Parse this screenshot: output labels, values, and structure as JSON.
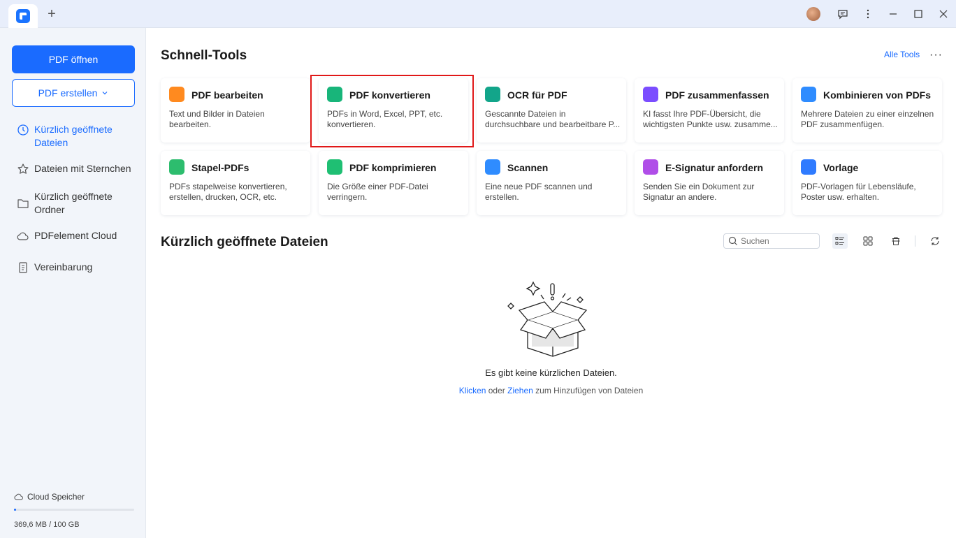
{
  "sidebar": {
    "open_pdf": "PDF öffnen",
    "create_pdf": "PDF erstellen",
    "nav": [
      {
        "label": "Kürzlich geöffnete Dateien",
        "active": true
      },
      {
        "label": "Dateien mit Sternchen"
      },
      {
        "label": "Kürzlich geöffnete Ordner"
      },
      {
        "label": "PDFelement Cloud"
      },
      {
        "label": "Vereinbarung"
      }
    ],
    "storage": {
      "title": "Cloud Speicher",
      "value": "369,6 MB / 100 GB",
      "used_fraction": 0.0036
    }
  },
  "quick_tools": {
    "title": "Schnell-Tools",
    "all_tools": "Alle Tools",
    "cards": [
      {
        "title": "PDF bearbeiten",
        "desc1": "Text und Bilder in Dateien",
        "desc2": "bearbeiten.",
        "color": "#ff8a1f",
        "icon": "edit-pdf-icon"
      },
      {
        "title": "PDF konvertieren",
        "desc1": "PDFs in Word, Excel, PPT, etc.",
        "desc2": "konvertieren.",
        "color": "#18b57a",
        "icon": "convert-pdf-icon"
      },
      {
        "title": "OCR für PDF",
        "desc1": "Gescannte Dateien in",
        "desc2": "durchsuchbare und bearbeitbare P...",
        "color": "#12a58a",
        "icon": "ocr-icon"
      },
      {
        "title": "PDF zusammenfassen",
        "desc1": "KI fasst Ihre PDF-Übersicht, die",
        "desc2": "wichtigsten Punkte usw. zusamme...",
        "color": "#7b4dff",
        "icon": "summarize-icon"
      },
      {
        "title": "Kombinieren von PDFs",
        "desc1": "Mehrere Dateien zu einer einzelnen",
        "desc2": "PDF zusammenfügen.",
        "color": "#2f8cff",
        "icon": "combine-icon"
      },
      {
        "title": "Stapel-PDFs",
        "desc1": "PDFs stapelweise konvertieren,",
        "desc2": "erstellen, drucken, OCR, etc.",
        "color": "#2dbd6e",
        "icon": "batch-icon"
      },
      {
        "title": "PDF komprimieren",
        "desc1": "Die Größe einer PDF-Datei",
        "desc2": "verringern.",
        "color": "#1fbf73",
        "icon": "compress-icon"
      },
      {
        "title": "Scannen",
        "desc1": "Eine neue PDF scannen und",
        "desc2": "erstellen.",
        "color": "#2f8cff",
        "icon": "scan-icon"
      },
      {
        "title": "E-Signatur anfordern",
        "desc1": "Senden Sie ein Dokument zur",
        "desc2": "Signatur an andere.",
        "color": "#b04ee8",
        "icon": "esign-icon"
      },
      {
        "title": "Vorlage",
        "desc1": "PDF-Vorlagen für Lebensläufe,",
        "desc2": "Poster usw. erhalten.",
        "color": "#2f7bff",
        "icon": "template-icon"
      }
    ]
  },
  "recent": {
    "title": "Kürzlich geöffnete Dateien",
    "search_placeholder": "Suchen",
    "empty_text": "Es gibt keine kürzlichen Dateien.",
    "hint_click": "Klicken",
    "hint_or": " oder ",
    "hint_drag": "Ziehen",
    "hint_rest": " zum Hinzufügen von Dateien"
  },
  "colors": {
    "accent": "#1a6bff",
    "highlight": "#e01818"
  }
}
